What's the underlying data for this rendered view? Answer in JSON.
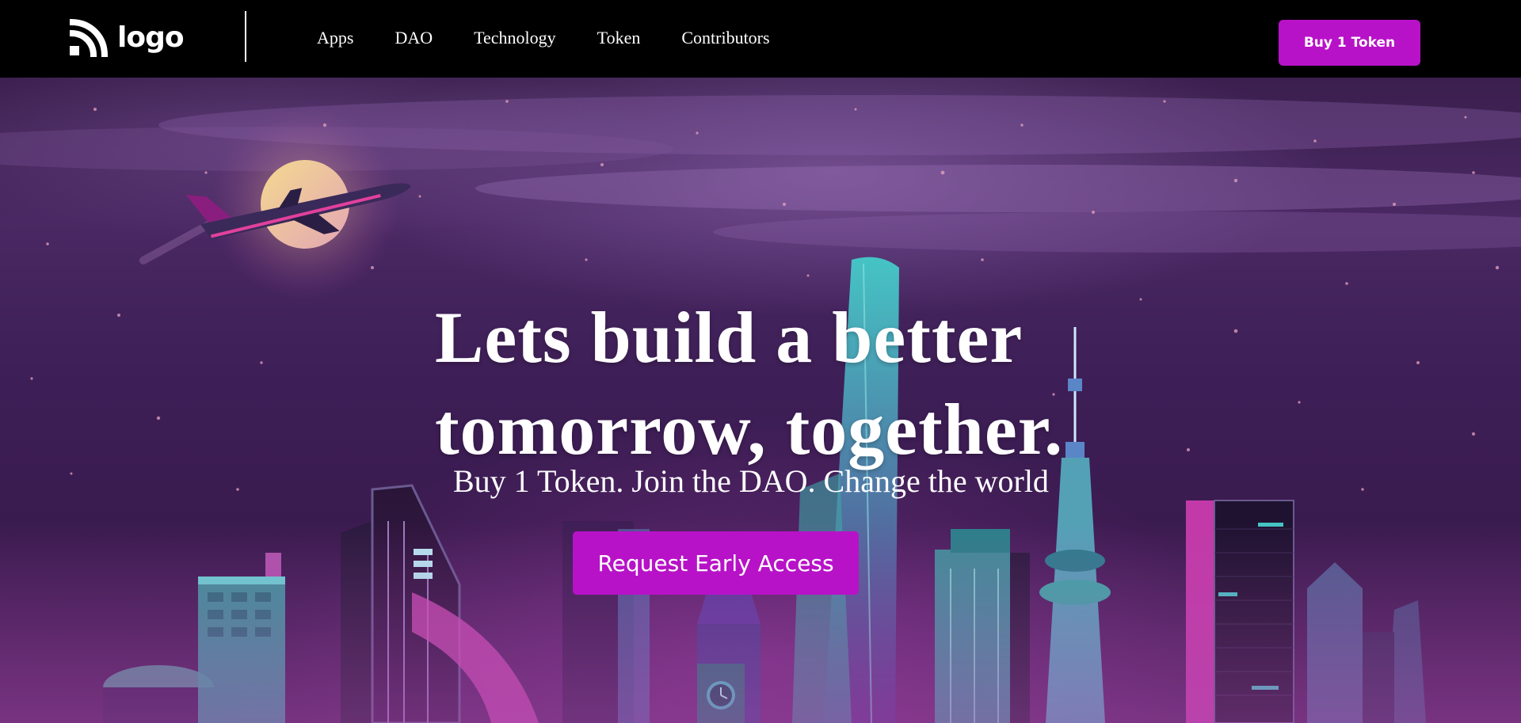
{
  "header": {
    "logo_text": "logo",
    "logo_icon": "wifi-arcs-logo-icon",
    "nav": [
      {
        "label": "Apps"
      },
      {
        "label": "DAO"
      },
      {
        "label": "Technology"
      },
      {
        "label": "Token"
      },
      {
        "label": "Contributors"
      }
    ],
    "cta_label": "Buy 1 Token"
  },
  "hero": {
    "headline_line1": "Lets build a better",
    "headline_line2": "tomorrow, together.",
    "subheadline": "Buy 1 Token. Join the DAO. Change the world",
    "cta_label": "Request Early Access",
    "background_icon": "night-city-skyline-illustration"
  },
  "colors": {
    "accent": "#b812c8",
    "header_bg": "#000000",
    "hero_bg": "#3d1e56",
    "text": "#ffffff"
  }
}
